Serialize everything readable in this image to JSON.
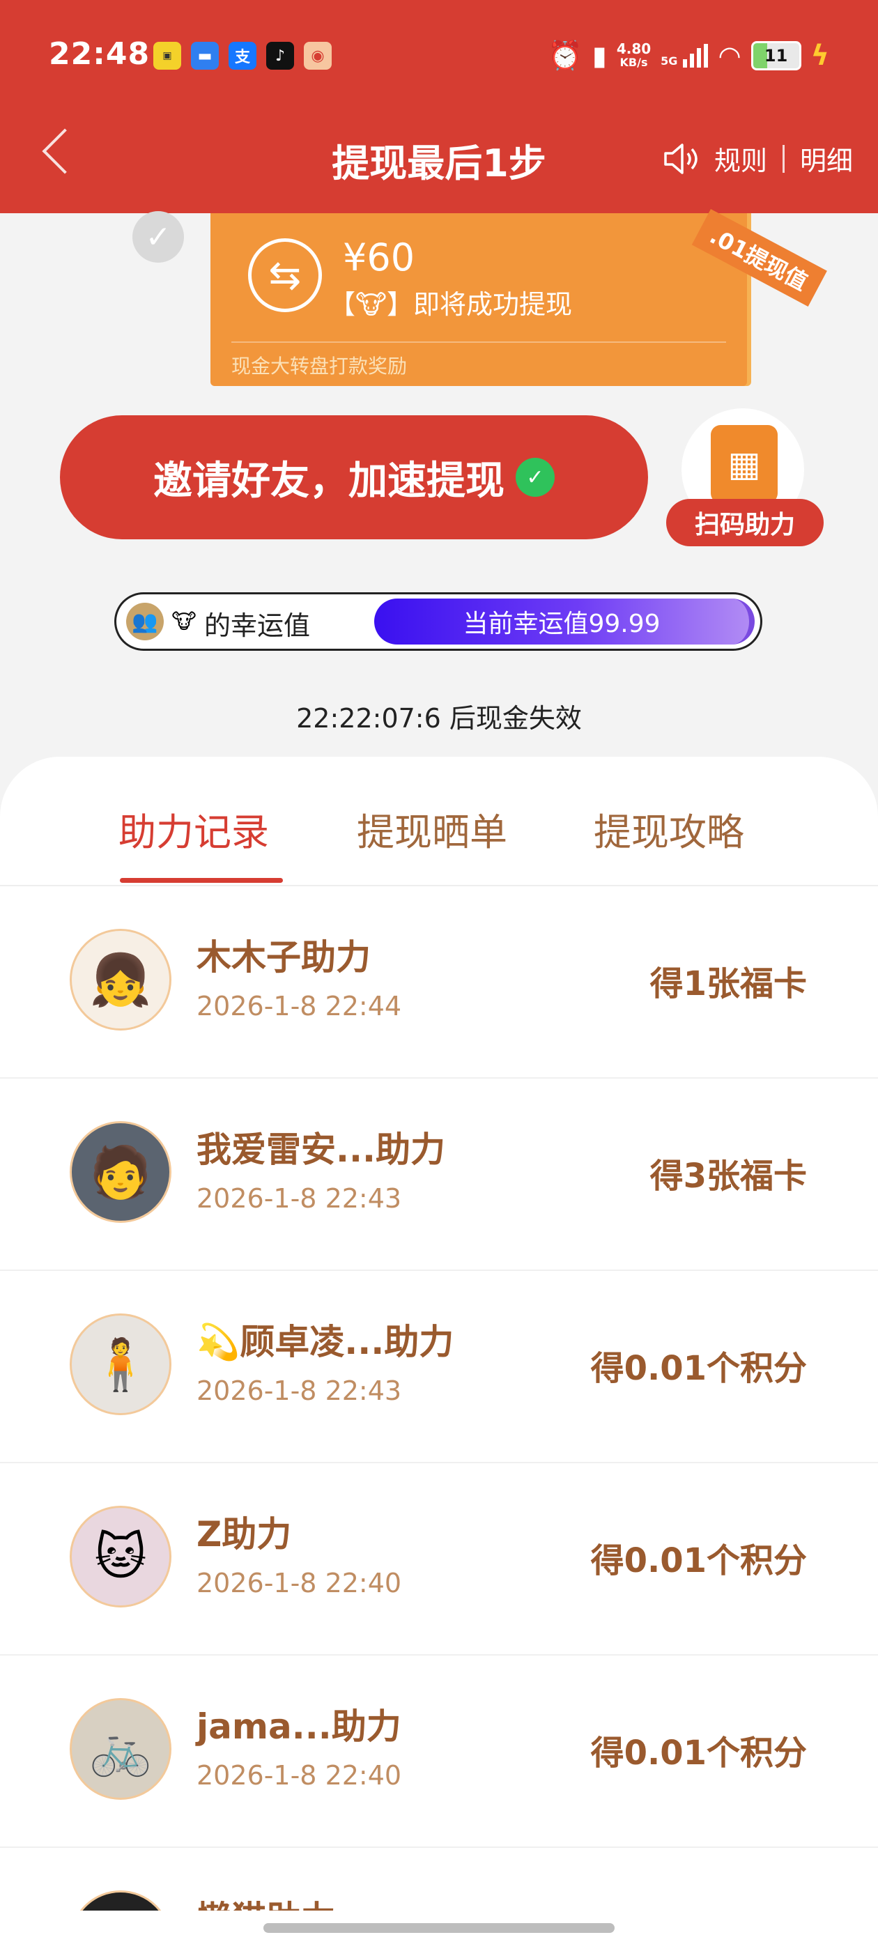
{
  "status_bar": {
    "time": "22:48",
    "net_speed_value": "4.80",
    "net_speed_unit": "KB/s",
    "signal": "5G",
    "battery": "11"
  },
  "nav": {
    "title": "提现最后1步",
    "rules": "规则",
    "details": "明细"
  },
  "cash_card": {
    "amount": "¥60",
    "status_text": "【🐮】即将成功提现",
    "source": "现金大转盘打款奖励",
    "ribbon": ".01提现值"
  },
  "invite": {
    "label": "邀请好友，加速提现",
    "scan_label": "扫码助力"
  },
  "luck": {
    "label": "的幸运值",
    "current": "当前幸运值99.99",
    "progress_percent": 99.99
  },
  "countdown": "22:22:07:6 后现金失效",
  "tabs": [
    {
      "label": "助力记录",
      "active": true
    },
    {
      "label": "提现晒单",
      "active": false
    },
    {
      "label": "提现攻略",
      "active": false
    }
  ],
  "records": [
    {
      "name": "木木子助力",
      "time": "2026-1-8 22:44",
      "reward": "得1张福卡"
    },
    {
      "name": "我爱雷安...助力",
      "time": "2026-1-8 22:43",
      "reward": "得3张福卡"
    },
    {
      "name": "💫顾卓凌...助力",
      "time": "2026-1-8 22:43",
      "reward": "得0.01个积分"
    },
    {
      "name": "Z助力",
      "time": "2026-1-8 22:40",
      "reward": "得0.01个积分"
    },
    {
      "name": "jama...助力",
      "time": "2026-1-8 22:40",
      "reward": "得0.01个积分"
    },
    {
      "name": "懒猫助力",
      "time": "",
      "reward": ""
    }
  ],
  "colors": {
    "brand_red": "#d63d32",
    "card_orange": "#f2963b",
    "record_brown": "#9a5a2e",
    "luck_purple": "#3a10f0"
  }
}
